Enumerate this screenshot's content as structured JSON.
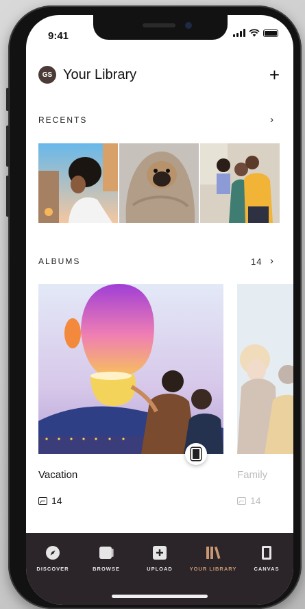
{
  "status": {
    "time": "9:41"
  },
  "header": {
    "avatar_initials": "GS",
    "title": "Your Library"
  },
  "recents": {
    "label": "RECENTS"
  },
  "albums": {
    "label": "ALBUMS",
    "count": "14",
    "items": [
      {
        "title": "Vacation",
        "count": "14"
      },
      {
        "title": "Family",
        "count": "14"
      }
    ]
  },
  "tabs": [
    {
      "label": "DISCOVER",
      "icon": "compass-icon"
    },
    {
      "label": "BROWSE",
      "icon": "browse-icon"
    },
    {
      "label": "UPLOAD",
      "icon": "upload-icon"
    },
    {
      "label": "YOUR LIBRARY",
      "icon": "library-icon",
      "active": true
    },
    {
      "label": "CANVAS",
      "icon": "canvas-icon"
    }
  ],
  "colors": {
    "accent": "#c79872",
    "tabbar_bg": "#2b2428"
  }
}
